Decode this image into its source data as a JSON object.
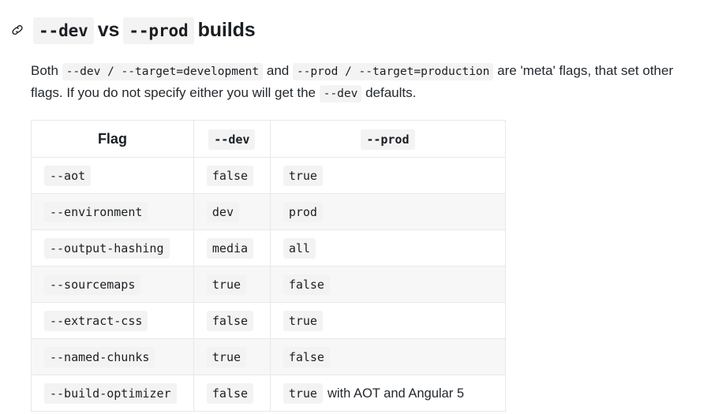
{
  "heading": {
    "anchor_icon": "link-icon",
    "parts": [
      {
        "type": "code",
        "text": "--dev"
      },
      {
        "type": "text",
        "text": "vs"
      },
      {
        "type": "code",
        "text": "--prod"
      },
      {
        "type": "text",
        "text": "builds"
      }
    ],
    "plain_text": "--dev vs --prod builds"
  },
  "intro": {
    "t1": "Both ",
    "c1": "--dev / --target=development",
    "t2": " and ",
    "c2": "--prod / --target=production",
    "t3": " are 'meta' flags, that set other flags. If you do not specify either you will get the ",
    "c3": "--dev",
    "t4": " defaults."
  },
  "table": {
    "headers": [
      {
        "label": "Flag",
        "style": "text"
      },
      {
        "label": "--dev",
        "style": "code"
      },
      {
        "label": "--prod",
        "style": "code"
      }
    ],
    "rows": [
      {
        "flag": "--aot",
        "dev": "false",
        "prod": "true",
        "prod_note": ""
      },
      {
        "flag": "--environment",
        "dev": "dev",
        "prod": "prod",
        "prod_note": ""
      },
      {
        "flag": "--output-hashing",
        "dev": "media",
        "prod": "all",
        "prod_note": ""
      },
      {
        "flag": "--sourcemaps",
        "dev": "true",
        "prod": "false",
        "prod_note": ""
      },
      {
        "flag": "--extract-css",
        "dev": "false",
        "prod": "true",
        "prod_note": ""
      },
      {
        "flag": "--named-chunks",
        "dev": "true",
        "prod": "false",
        "prod_note": ""
      },
      {
        "flag": "--build-optimizer",
        "dev": "false",
        "prod": "true",
        "prod_note": "with AOT and Angular 5"
      }
    ]
  },
  "colors": {
    "page_bg": "#ffffff",
    "text": "#24292e",
    "code_bg": "#f3f3f3",
    "row_alt_bg": "#f7f7f7",
    "border": "#e8e8e8"
  }
}
